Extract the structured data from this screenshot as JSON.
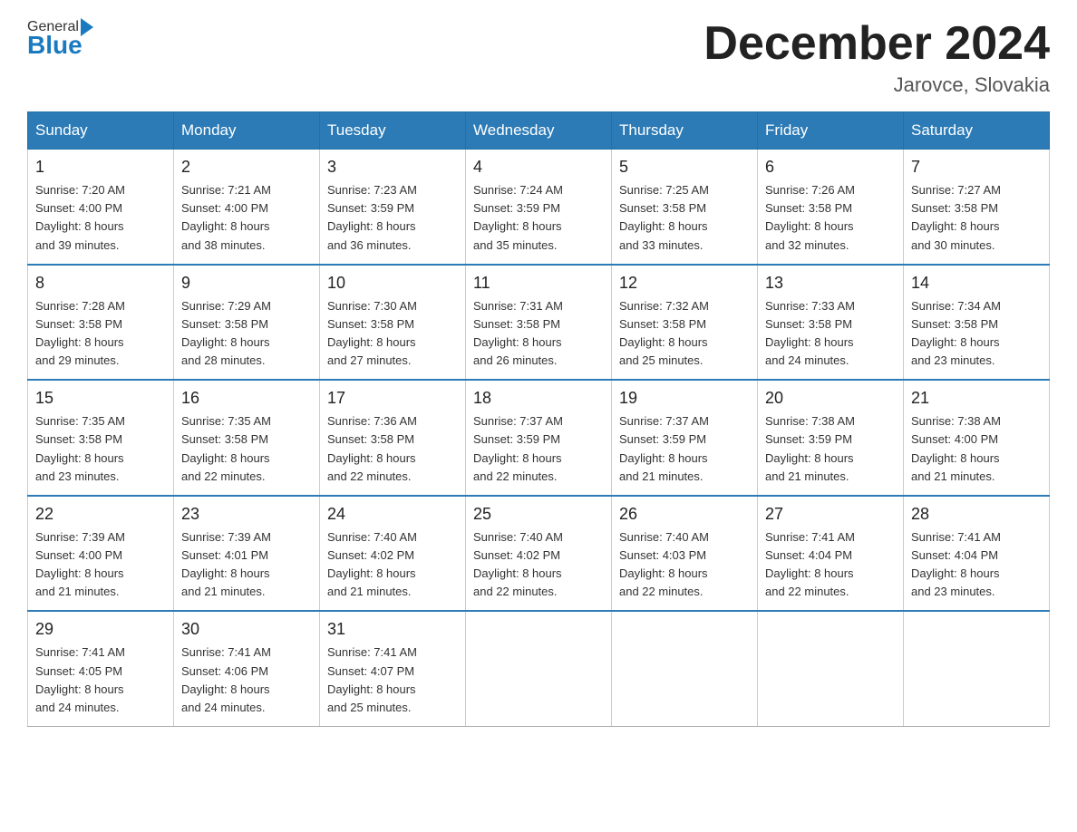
{
  "header": {
    "logo_general": "General",
    "logo_blue": "Blue",
    "title": "December 2024",
    "location": "Jarovce, Slovakia"
  },
  "weekdays": [
    "Sunday",
    "Monday",
    "Tuesday",
    "Wednesday",
    "Thursday",
    "Friday",
    "Saturday"
  ],
  "weeks": [
    [
      {
        "day": "1",
        "info": "Sunrise: 7:20 AM\nSunset: 4:00 PM\nDaylight: 8 hours\nand 39 minutes."
      },
      {
        "day": "2",
        "info": "Sunrise: 7:21 AM\nSunset: 4:00 PM\nDaylight: 8 hours\nand 38 minutes."
      },
      {
        "day": "3",
        "info": "Sunrise: 7:23 AM\nSunset: 3:59 PM\nDaylight: 8 hours\nand 36 minutes."
      },
      {
        "day": "4",
        "info": "Sunrise: 7:24 AM\nSunset: 3:59 PM\nDaylight: 8 hours\nand 35 minutes."
      },
      {
        "day": "5",
        "info": "Sunrise: 7:25 AM\nSunset: 3:58 PM\nDaylight: 8 hours\nand 33 minutes."
      },
      {
        "day": "6",
        "info": "Sunrise: 7:26 AM\nSunset: 3:58 PM\nDaylight: 8 hours\nand 32 minutes."
      },
      {
        "day": "7",
        "info": "Sunrise: 7:27 AM\nSunset: 3:58 PM\nDaylight: 8 hours\nand 30 minutes."
      }
    ],
    [
      {
        "day": "8",
        "info": "Sunrise: 7:28 AM\nSunset: 3:58 PM\nDaylight: 8 hours\nand 29 minutes."
      },
      {
        "day": "9",
        "info": "Sunrise: 7:29 AM\nSunset: 3:58 PM\nDaylight: 8 hours\nand 28 minutes."
      },
      {
        "day": "10",
        "info": "Sunrise: 7:30 AM\nSunset: 3:58 PM\nDaylight: 8 hours\nand 27 minutes."
      },
      {
        "day": "11",
        "info": "Sunrise: 7:31 AM\nSunset: 3:58 PM\nDaylight: 8 hours\nand 26 minutes."
      },
      {
        "day": "12",
        "info": "Sunrise: 7:32 AM\nSunset: 3:58 PM\nDaylight: 8 hours\nand 25 minutes."
      },
      {
        "day": "13",
        "info": "Sunrise: 7:33 AM\nSunset: 3:58 PM\nDaylight: 8 hours\nand 24 minutes."
      },
      {
        "day": "14",
        "info": "Sunrise: 7:34 AM\nSunset: 3:58 PM\nDaylight: 8 hours\nand 23 minutes."
      }
    ],
    [
      {
        "day": "15",
        "info": "Sunrise: 7:35 AM\nSunset: 3:58 PM\nDaylight: 8 hours\nand 23 minutes."
      },
      {
        "day": "16",
        "info": "Sunrise: 7:35 AM\nSunset: 3:58 PM\nDaylight: 8 hours\nand 22 minutes."
      },
      {
        "day": "17",
        "info": "Sunrise: 7:36 AM\nSunset: 3:58 PM\nDaylight: 8 hours\nand 22 minutes."
      },
      {
        "day": "18",
        "info": "Sunrise: 7:37 AM\nSunset: 3:59 PM\nDaylight: 8 hours\nand 22 minutes."
      },
      {
        "day": "19",
        "info": "Sunrise: 7:37 AM\nSunset: 3:59 PM\nDaylight: 8 hours\nand 21 minutes."
      },
      {
        "day": "20",
        "info": "Sunrise: 7:38 AM\nSunset: 3:59 PM\nDaylight: 8 hours\nand 21 minutes."
      },
      {
        "day": "21",
        "info": "Sunrise: 7:38 AM\nSunset: 4:00 PM\nDaylight: 8 hours\nand 21 minutes."
      }
    ],
    [
      {
        "day": "22",
        "info": "Sunrise: 7:39 AM\nSunset: 4:00 PM\nDaylight: 8 hours\nand 21 minutes."
      },
      {
        "day": "23",
        "info": "Sunrise: 7:39 AM\nSunset: 4:01 PM\nDaylight: 8 hours\nand 21 minutes."
      },
      {
        "day": "24",
        "info": "Sunrise: 7:40 AM\nSunset: 4:02 PM\nDaylight: 8 hours\nand 21 minutes."
      },
      {
        "day": "25",
        "info": "Sunrise: 7:40 AM\nSunset: 4:02 PM\nDaylight: 8 hours\nand 22 minutes."
      },
      {
        "day": "26",
        "info": "Sunrise: 7:40 AM\nSunset: 4:03 PM\nDaylight: 8 hours\nand 22 minutes."
      },
      {
        "day": "27",
        "info": "Sunrise: 7:41 AM\nSunset: 4:04 PM\nDaylight: 8 hours\nand 22 minutes."
      },
      {
        "day": "28",
        "info": "Sunrise: 7:41 AM\nSunset: 4:04 PM\nDaylight: 8 hours\nand 23 minutes."
      }
    ],
    [
      {
        "day": "29",
        "info": "Sunrise: 7:41 AM\nSunset: 4:05 PM\nDaylight: 8 hours\nand 24 minutes."
      },
      {
        "day": "30",
        "info": "Sunrise: 7:41 AM\nSunset: 4:06 PM\nDaylight: 8 hours\nand 24 minutes."
      },
      {
        "day": "31",
        "info": "Sunrise: 7:41 AM\nSunset: 4:07 PM\nDaylight: 8 hours\nand 25 minutes."
      },
      {
        "day": "",
        "info": ""
      },
      {
        "day": "",
        "info": ""
      },
      {
        "day": "",
        "info": ""
      },
      {
        "day": "",
        "info": ""
      }
    ]
  ]
}
